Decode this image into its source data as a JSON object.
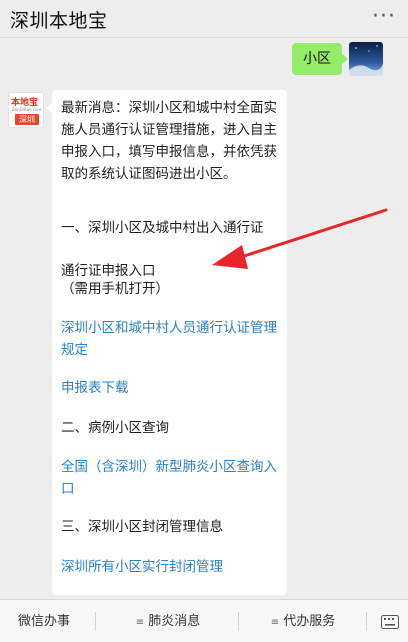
{
  "header": {
    "title": "深圳本地宝",
    "more": "···"
  },
  "user_message": {
    "text": "小区"
  },
  "bot": {
    "logo": {
      "brand": "本地宝",
      "site": "BenDiBao.com",
      "city": "深圳"
    },
    "lines": [
      {
        "text": "最新消息：深圳小区和城中村全面实施人员通行认证管理措施，进入自主申报入口，填写申报信息，并依凭获取的系统认证图码进出小区。",
        "link": false
      },
      {
        "text": "一、深圳小区及城中村出入通行证",
        "link": false
      },
      {
        "text": "通行证申报入口",
        "link": false
      },
      {
        "text": "（需用手机打开）",
        "link": false
      },
      {
        "text": "深圳小区和城中村人员通行认证管理规定",
        "link": true
      },
      {
        "text": "申报表下载",
        "link": true
      },
      {
        "text": "二、病例小区查询",
        "link": false
      },
      {
        "text": "全国（含深圳）新型肺炎小区查询入口",
        "link": true
      },
      {
        "text": "三、深圳小区封闭管理信息",
        "link": false
      },
      {
        "text": "深圳所有小区实行封闭管理",
        "link": true
      }
    ]
  },
  "colors": {
    "background": "#ededed",
    "user_bubble": "#95ec69",
    "link": "#2a82c7",
    "arrow": "#e8262a"
  },
  "menu": {
    "items": [
      "微信办事",
      "肺炎消息",
      "代办服务"
    ],
    "icons": [
      "keyboard-icon"
    ]
  }
}
